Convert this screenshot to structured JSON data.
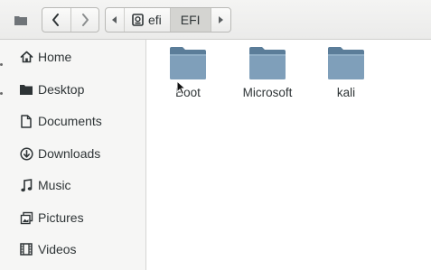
{
  "header": {
    "icons": {
      "sidebar_toggle": "folder-small-icon",
      "back": "chevron-left-icon",
      "forward": "chevron-right-icon",
      "path_left": "triangle-left-icon",
      "path_right": "triangle-right-icon",
      "drive": "drive-icon"
    },
    "path": [
      {
        "label": "efi"
      },
      {
        "label": "EFI",
        "active": true
      }
    ]
  },
  "sidebar": {
    "items": [
      {
        "label": "Home",
        "icon": "home-icon"
      },
      {
        "label": "Desktop",
        "icon": "folder-icon"
      },
      {
        "label": "Documents",
        "icon": "document-icon"
      },
      {
        "label": "Downloads",
        "icon": "download-icon"
      },
      {
        "label": "Music",
        "icon": "music-icon"
      },
      {
        "label": "Pictures",
        "icon": "pictures-icon"
      },
      {
        "label": "Videos",
        "icon": "videos-icon"
      }
    ]
  },
  "content": {
    "items": [
      {
        "label": "Boot",
        "icon": "folder-icon"
      },
      {
        "label": "Microsoft",
        "icon": "folder-icon"
      },
      {
        "label": "kali",
        "icon": "folder-icon"
      }
    ]
  },
  "colors": {
    "folder_top": "#5b7d99",
    "folder_body": "#7f9fba",
    "header_bg": "#eeeeec",
    "sidebar_bg": "#f6f6f5",
    "text": "#2e3436"
  }
}
